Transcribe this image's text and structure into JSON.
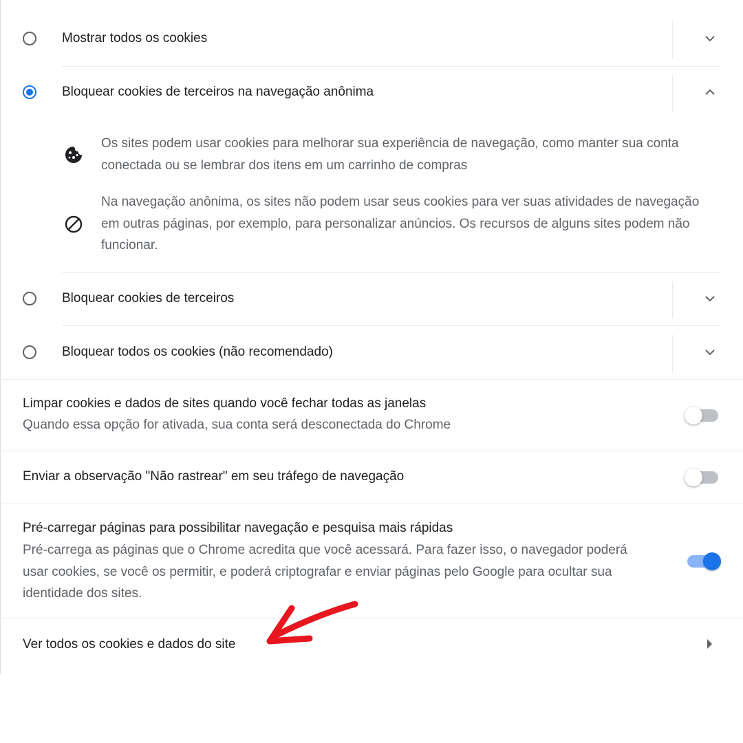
{
  "cookie_options": [
    {
      "label": "Mostrar todos os cookies",
      "selected": false,
      "expanded": false
    },
    {
      "label": "Bloquear cookies de terceiros na navegação anônima",
      "selected": true,
      "expanded": true,
      "details": [
        {
          "icon": "cookie-icon",
          "text": "Os sites podem usar cookies para melhorar sua experiência de navegação, como manter sua conta conectada ou se lembrar dos itens em um carrinho de compras"
        },
        {
          "icon": "block-icon",
          "text": "Na navegação anônima, os sites não podem usar seus cookies para ver suas atividades de navegação em outras páginas, por exemplo, para personalizar anúncios. Os recursos de alguns sites podem não funcionar."
        }
      ]
    },
    {
      "label": "Bloquear cookies de terceiros",
      "selected": false,
      "expanded": false
    },
    {
      "label": "Bloquear todos os cookies (não recomendado)",
      "selected": false,
      "expanded": false
    }
  ],
  "settings": {
    "clear_on_exit": {
      "title": "Limpar cookies e dados de sites quando você fechar todas as janelas",
      "subtitle": "Quando essa opção for ativada, sua conta será desconectada do Chrome",
      "enabled": false
    },
    "do_not_track": {
      "title": "Enviar a observação \"Não rastrear\" em seu tráfego de navegação",
      "enabled": false
    },
    "preload": {
      "title": "Pré-carregar páginas para possibilitar navegação e pesquisa mais rápidas",
      "subtitle": "Pré-carrega as páginas que o Chrome acredita que você acessará. Para fazer isso, o navegador poderá usar cookies, se você os permitir, e poderá criptografar e enviar páginas pelo Google para ocultar sua identidade dos sites.",
      "enabled": true
    }
  },
  "see_all_link": {
    "label": "Ver todos os cookies e dados do site",
    "icon": "arrow-right-icon"
  },
  "colors": {
    "accent": "#1a73e8",
    "annotation_arrow": "#e8161e",
    "secondary_text": "#5f6368",
    "divider": "#e8eaed"
  }
}
